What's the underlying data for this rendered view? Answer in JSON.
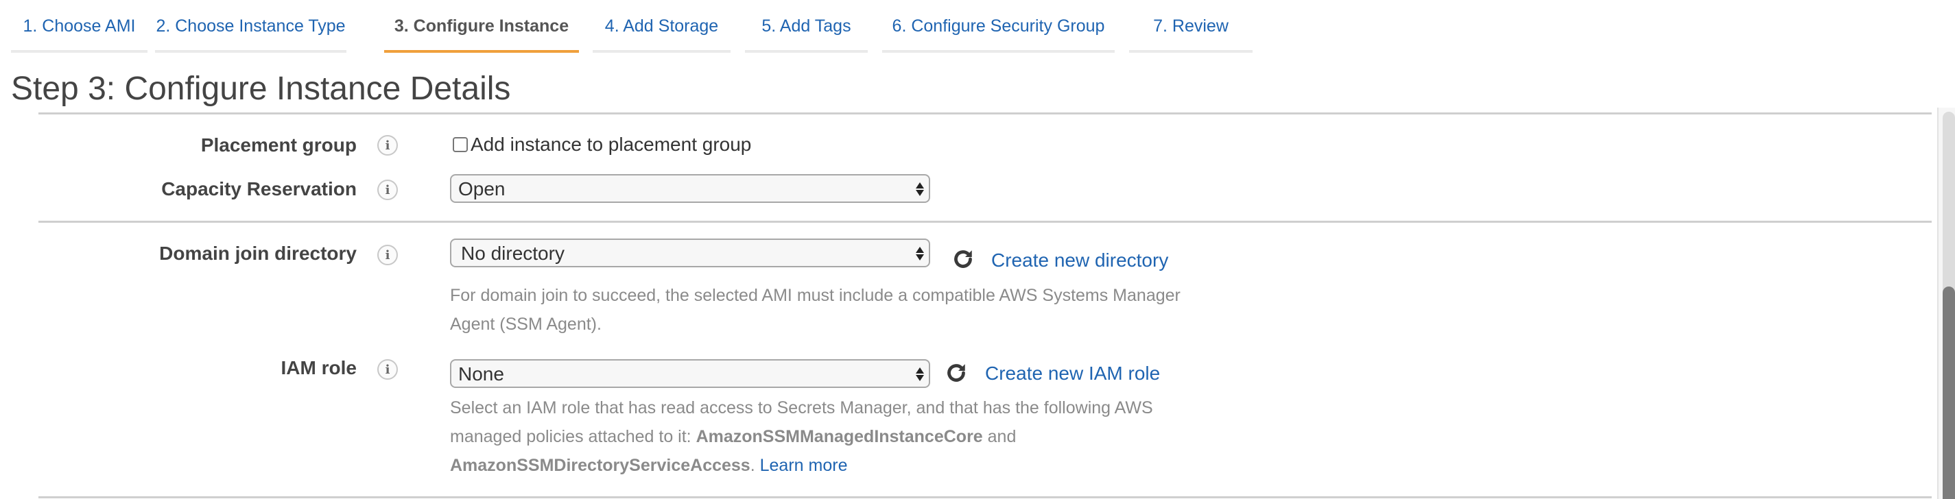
{
  "tabs": [
    {
      "label": "1. Choose AMI",
      "active": false
    },
    {
      "label": "2. Choose Instance Type",
      "active": false
    },
    {
      "label": "3. Configure Instance",
      "active": true
    },
    {
      "label": "4. Add Storage",
      "active": false
    },
    {
      "label": "5. Add Tags",
      "active": false
    },
    {
      "label": "6. Configure Security Group",
      "active": false
    },
    {
      "label": "7. Review",
      "active": false
    }
  ],
  "page_title": "Step 3: Configure Instance Details",
  "fields": {
    "placement_group": {
      "label": "Placement group",
      "info_icon": "info-icon",
      "checkbox_label": "Add instance to placement group",
      "checked": false
    },
    "capacity_reservation": {
      "label": "Capacity Reservation",
      "info_icon": "info-icon",
      "selected": "Open"
    },
    "domain_join": {
      "label": "Domain join directory",
      "info_icon": "info-icon",
      "selected": "No directory",
      "refresh_icon": "refresh-icon",
      "create_link": "Create new directory",
      "help_text": "For domain join to succeed, the selected AMI must include a compatible AWS Systems Manager Agent (SSM Agent)."
    },
    "iam_role": {
      "label": "IAM role",
      "info_icon": "info-icon",
      "selected": "None",
      "refresh_icon": "refresh-icon",
      "create_link": "Create new IAM role",
      "help_prefix": "Select an IAM role that has read access to Secrets Manager, and that has the following AWS managed policies attached to it: ",
      "policy_1": "AmazonSSMManagedInstanceCore",
      "help_and": " and ",
      "policy_2": "AmazonSSMDirectoryServiceAccess",
      "help_suffix": ". ",
      "learn_more": "Learn more"
    }
  },
  "colors": {
    "link": "#1f64b1",
    "active_tab_underline": "#f0a03c",
    "inactive_tab_underline": "#eaeaea",
    "help_text": "#8a8a8a"
  },
  "scrollbar": {
    "position_fraction": 0.45
  }
}
